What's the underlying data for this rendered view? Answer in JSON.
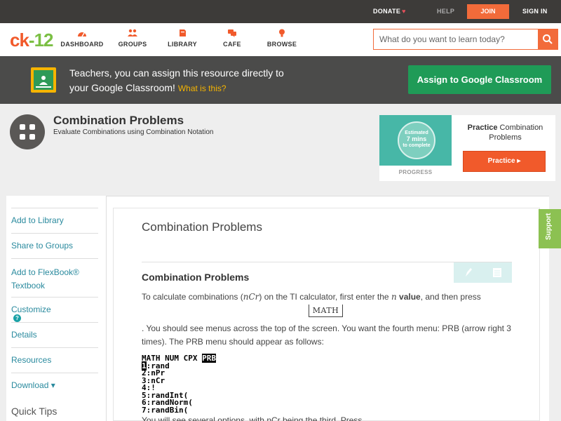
{
  "topbar": {
    "donate": "DONATE",
    "help": "HELP",
    "join": "JOIN",
    "signin": "SIGN IN"
  },
  "nav": {
    "logo_ck": "ck",
    "logo_12": "-12",
    "items": [
      {
        "label": "DASHBOARD",
        "icon": "dashboard-icon"
      },
      {
        "label": "GROUPS",
        "icon": "groups-icon"
      },
      {
        "label": "LIBRARY",
        "icon": "library-icon"
      },
      {
        "label": "CAFE",
        "icon": "cafe-icon"
      },
      {
        "label": "BROWSE",
        "icon": "browse-icon"
      }
    ],
    "search_placeholder": "What do you want to learn today?"
  },
  "banner": {
    "line1": "Teachers, you can assign this resource directly to",
    "line2": "your Google Classroom!",
    "what_is_this": "What is this?",
    "assign_button": "Assign to Google Classroom"
  },
  "header": {
    "title": "Combination Problems",
    "subtitle": "Evaluate Combinations using Combination Notation"
  },
  "practice": {
    "estimated": "Estimated",
    "mins": "7 mins",
    "to_complete": "to complete",
    "progress_label": "PROGRESS",
    "title_bold": "Practice",
    "title_rest": "Combination Problems",
    "button": "Practice"
  },
  "sidebar": {
    "items": [
      "Add to Library",
      "Share to Groups",
      "Add to FlexBook® Textbook",
      "Customize",
      "Details",
      "Resources",
      "Download ▾"
    ],
    "quick_tips": "Quick Tips"
  },
  "article": {
    "title": "Combination Problems",
    "heading": "Combination Problems",
    "p1_a": "To calculate combinations (",
    "p1_math": "nCr",
    "p1_b": ") on the TI calculator, first enter the ",
    "p1_n": "n",
    "p1_value": "value",
    "p1_c": ", and then press",
    "math_key": "MATH",
    "p2": ". You should see menus across the top of the screen. You want the fourth menu: PRB (arrow right 3 times). The PRB menu should appear as follows:",
    "calc_header": "MATH NUM CPX ",
    "calc_prb": "PRB",
    "calc_lines": [
      "1:rand",
      "2:nPr",
      "3:nCr",
      "4:!",
      "5:randInt(",
      "6:randNorm(",
      "7:randBin("
    ],
    "p3": "You will see several options, with nCr being the third. Press"
  },
  "support": "Support",
  "colors": {
    "accent_orange": "#f26b3a",
    "google_green": "#1f9b57",
    "link_teal": "#2a8a9e",
    "support_green": "#8cc152"
  }
}
